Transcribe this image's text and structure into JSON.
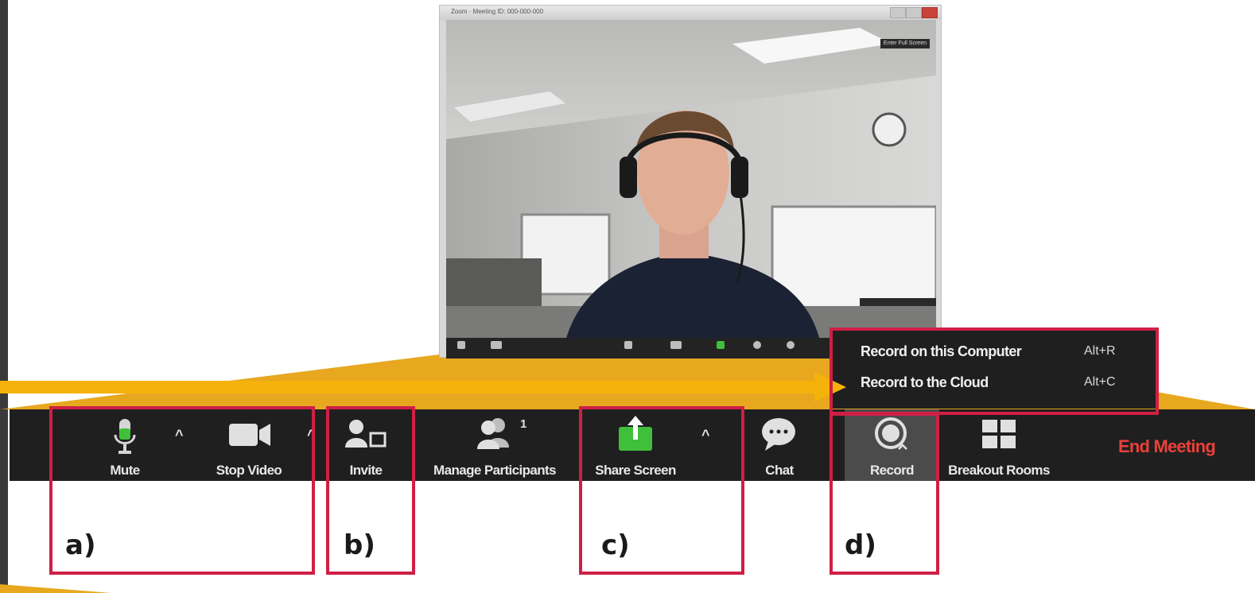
{
  "window": {
    "title": "Zoom · Meeting ID: 000-000-000",
    "fullscreen_label": "Enter Full Screen"
  },
  "toolbar": {
    "mute_label": "Mute",
    "stop_video_label": "Stop Video",
    "invite_label": "Invite",
    "manage_participants_label": "Manage Participants",
    "participant_count": "1",
    "share_screen_label": "Share Screen",
    "chat_label": "Chat",
    "record_label": "Record",
    "breakout_rooms_label": "Breakout Rooms",
    "end_meeting_label": "End Meeting"
  },
  "record_menu": {
    "items": [
      {
        "label": "Record on this Computer",
        "shortcut": "Alt+R"
      },
      {
        "label": "Record to the Cloud",
        "shortcut": "Alt+C"
      }
    ]
  },
  "annotations": {
    "a": "a)",
    "b": "b)",
    "c": "c)",
    "d": "d)"
  },
  "colors": {
    "toolbar_bg": "#1f1f1f",
    "end_meeting": "#e8413a",
    "highlight_box": "#cf1f45",
    "arrow": "#f5b20a",
    "share_green": "#3fbf3a"
  }
}
